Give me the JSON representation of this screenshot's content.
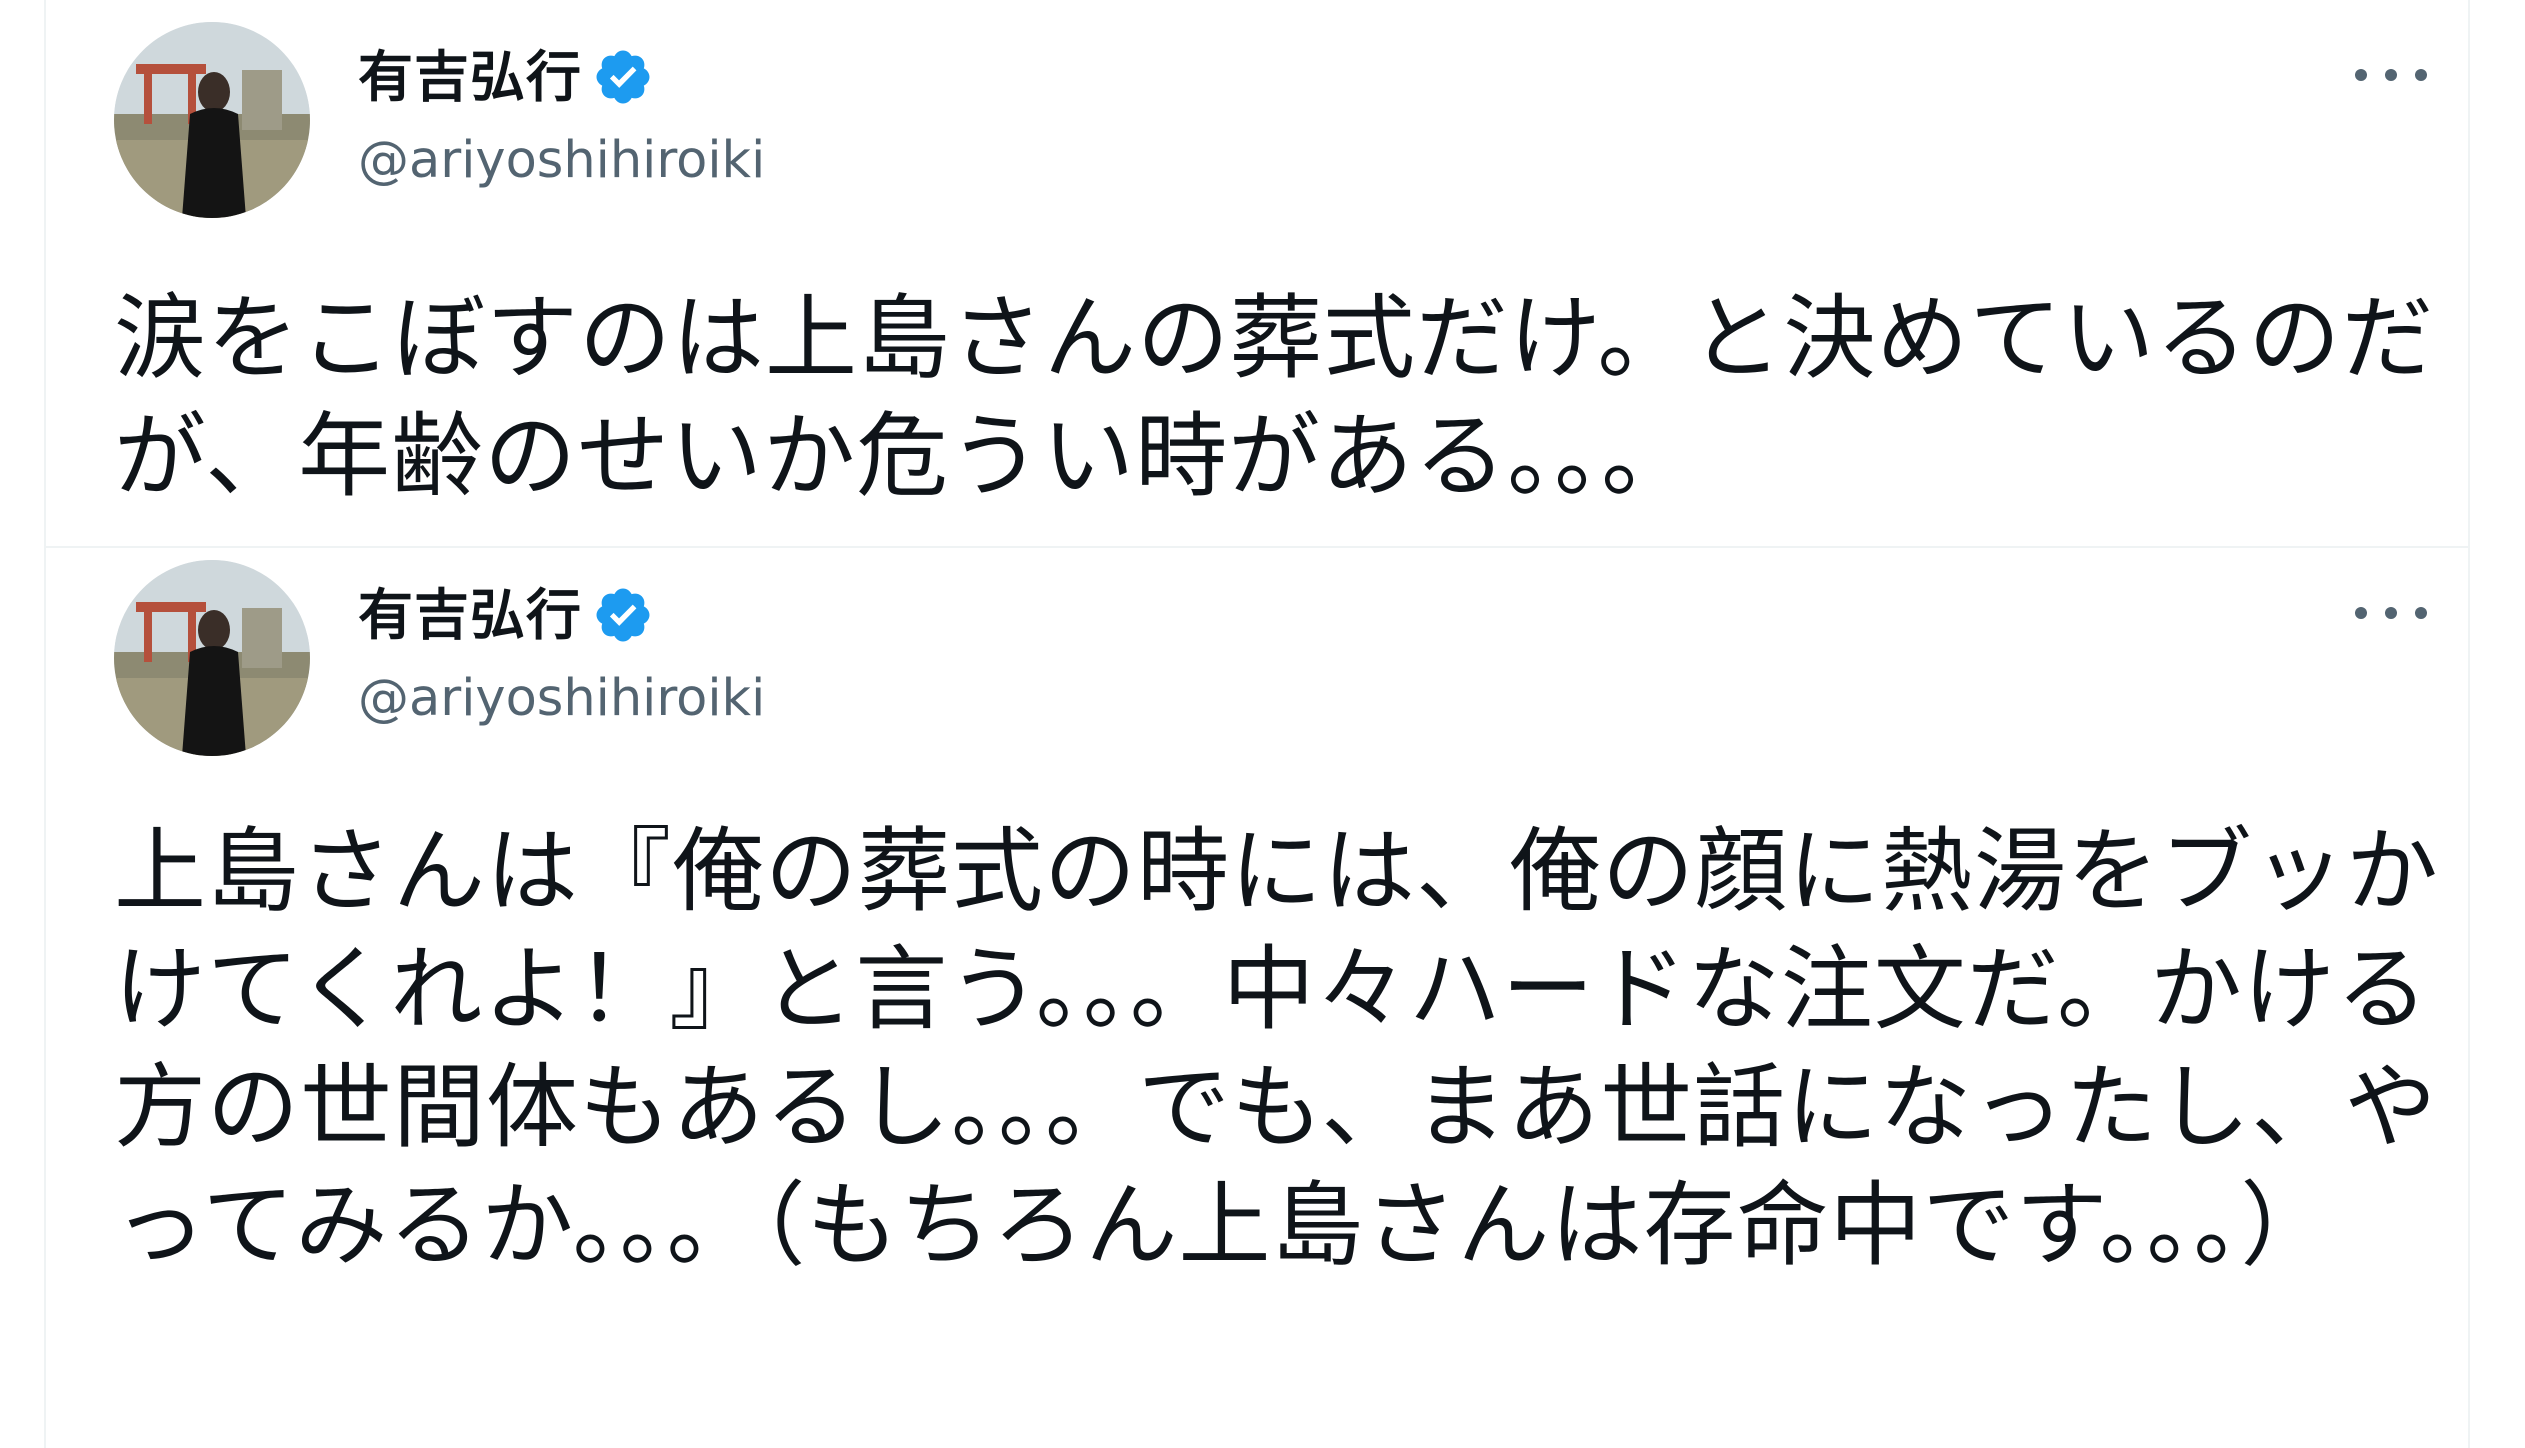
{
  "tweets": [
    {
      "display_name": "有吉弘行",
      "handle": "@ariyoshihiroiki",
      "verified": true,
      "avatar_icon": "profile-photo-icon",
      "more_icon": "more-options-icon",
      "text": "涙をこぼすのは上島さんの葬式だけ。と決めているのだが、年齢のせいか危うい時がある。。。"
    },
    {
      "display_name": "有吉弘行",
      "handle": "@ariyoshihiroiki",
      "verified": true,
      "avatar_icon": "profile-photo-icon",
      "more_icon": "more-options-icon",
      "text": "上島さんは『俺の葬式の時には、俺の顔に熱湯をブッかけてくれよ！』と言う。。。中々ハードな注文だ。かける方の世間体もあるし。。。でも、まあ世話になったし、やってみるか。。。（もちろん上島さんは存命中です。。。）"
    }
  ],
  "colors": {
    "verified_blue": "#1d9bf0",
    "secondary_text": "#536471",
    "primary_text": "#0f1419",
    "divider": "#eff3f4"
  }
}
